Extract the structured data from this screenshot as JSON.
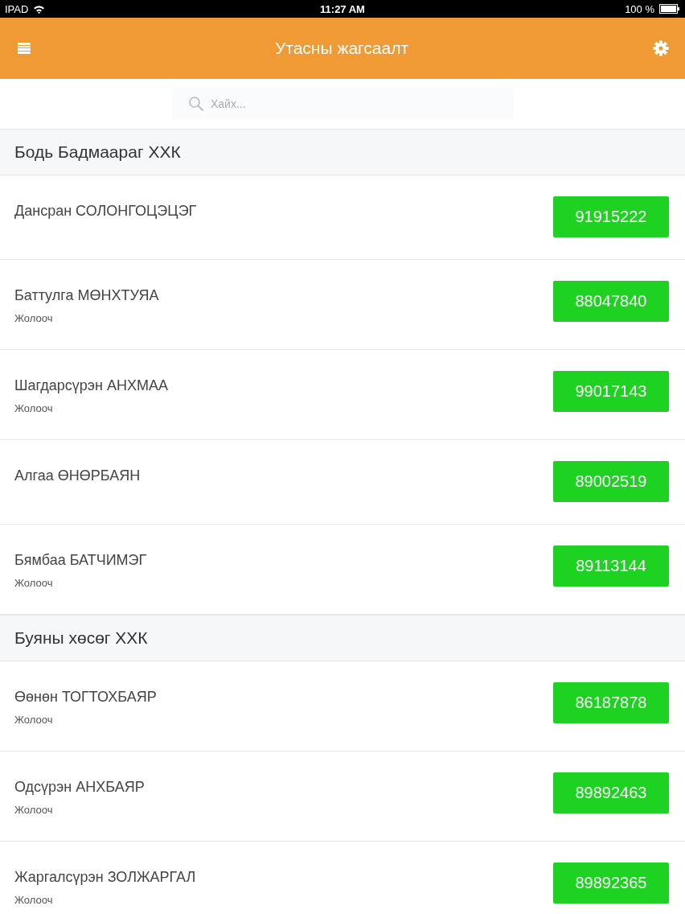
{
  "status_bar": {
    "carrier": "IPAD",
    "time": "11:27 AM",
    "battery": "100 %"
  },
  "header": {
    "title": "Утасны жагсаалт"
  },
  "search": {
    "placeholder": "Хайх..."
  },
  "groups": [
    {
      "name": "Бодь Бадмаараг ХХК",
      "contacts": [
        {
          "name": "Дансран СОЛОНГОЦЭЦЭГ",
          "phone": "91915222"
        },
        {
          "name": "Баттулга МӨНХТУЯА",
          "role": "Жолооч",
          "phone": "88047840"
        },
        {
          "name": "Шагдарсүрэн АНХМАА",
          "role": "Жолооч",
          "phone": "99017143"
        },
        {
          "name": "Алгаа ӨНӨРБАЯН",
          "phone": "89002519"
        },
        {
          "name": "Бямбаа БАТЧИМЭГ",
          "role": "Жолооч",
          "phone": "89113144"
        }
      ]
    },
    {
      "name": "Буяны хөсөг ХХК",
      "contacts": [
        {
          "name": "Өөнөн ТОГТОХБАЯР",
          "role": "Жолооч",
          "phone": "86187878"
        },
        {
          "name": "Одсүрэн АНХБАЯР",
          "role": "Жолооч",
          "phone": "89892463"
        },
        {
          "name": "Жаргалсүрэн ЗОЛЖАРГАЛ",
          "role": "Жолооч",
          "phone": "89892365"
        }
      ]
    }
  ]
}
